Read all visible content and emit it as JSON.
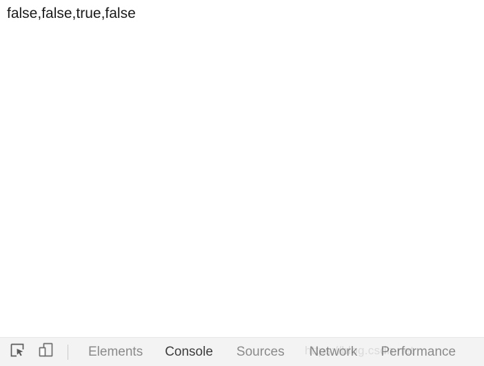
{
  "page": {
    "console_output": "false,false,true,false"
  },
  "devtools": {
    "toolbar": {
      "inspect_icon": "inspect-element-icon",
      "device_icon": "device-toolbar-icon"
    },
    "tabs": [
      {
        "id": "elements",
        "label": "Elements",
        "active": false
      },
      {
        "id": "console",
        "label": "Console",
        "active": true
      },
      {
        "id": "sources",
        "label": "Sources",
        "active": false
      },
      {
        "id": "network",
        "label": "Network",
        "active": false
      },
      {
        "id": "performance",
        "label": "Performance",
        "active": false
      }
    ],
    "colors": {
      "panel_background": "#f3f3f3",
      "tab_inactive": "#8a8a8a",
      "tab_active": "#3c3c3c",
      "separator": "#c9c9c9"
    }
  },
  "watermark": {
    "text": "https://blog.csdn.net"
  }
}
